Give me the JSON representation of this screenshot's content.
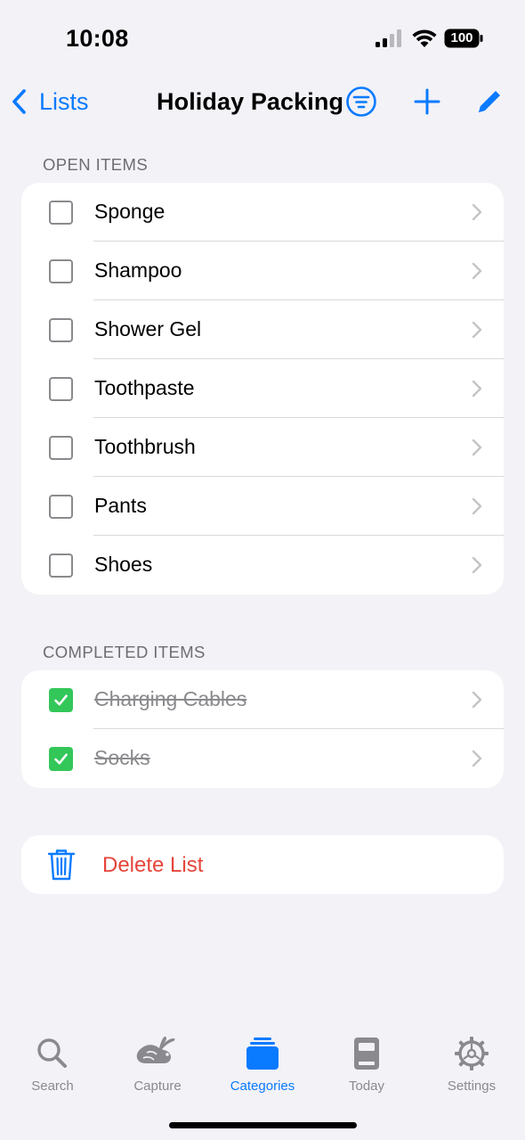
{
  "status_bar": {
    "time": "10:08",
    "battery": "100"
  },
  "nav": {
    "back_label": "Lists",
    "title": "Holiday Packing",
    "accent_color": "#0a7aff",
    "icons": [
      "filter-icon",
      "plus-icon",
      "pencil-icon"
    ]
  },
  "open_section": {
    "header": "OPEN ITEMS",
    "items": [
      {
        "label": "Sponge",
        "checked": false
      },
      {
        "label": "Shampoo",
        "checked": false
      },
      {
        "label": "Shower Gel",
        "checked": false
      },
      {
        "label": "Toothpaste",
        "checked": false
      },
      {
        "label": "Toothbrush",
        "checked": false
      },
      {
        "label": "Pants",
        "checked": false
      },
      {
        "label": "Shoes",
        "checked": false
      }
    ]
  },
  "completed_section": {
    "header": "COMPLETED ITEMS",
    "items": [
      {
        "label": "Charging Cables",
        "checked": true
      },
      {
        "label": "Socks",
        "checked": true
      }
    ]
  },
  "delete": {
    "label": "Delete List",
    "color": "#e5453a"
  },
  "tab_bar": {
    "tabs": [
      {
        "label": "Search",
        "icon": "magnifier-icon",
        "active": false
      },
      {
        "label": "Capture",
        "icon": "rabbit-icon",
        "active": false
      },
      {
        "label": "Categories",
        "icon": "stack-icon",
        "active": true
      },
      {
        "label": "Today",
        "icon": "book-icon",
        "active": false
      },
      {
        "label": "Settings",
        "icon": "gear-icon",
        "active": false
      }
    ]
  }
}
